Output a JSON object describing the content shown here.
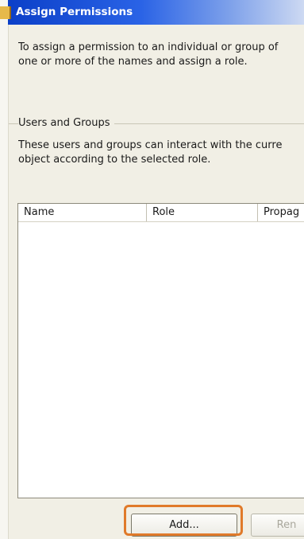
{
  "window": {
    "title": "Assign Permissions"
  },
  "intro": {
    "text": "To assign a permission to an individual or group of\none or more of the names and assign a role."
  },
  "users_groups": {
    "label": "Users and Groups",
    "description": "These users and groups can interact with the curre\nobject according to the selected role.",
    "columns": [
      "Name",
      "Role",
      "Propag"
    ],
    "rows": []
  },
  "buttons": {
    "add_label": "Add...",
    "remove_label": "Ren"
  },
  "colors": {
    "highlight": "#e07a2a",
    "titlebar": "#0b3fc8"
  }
}
